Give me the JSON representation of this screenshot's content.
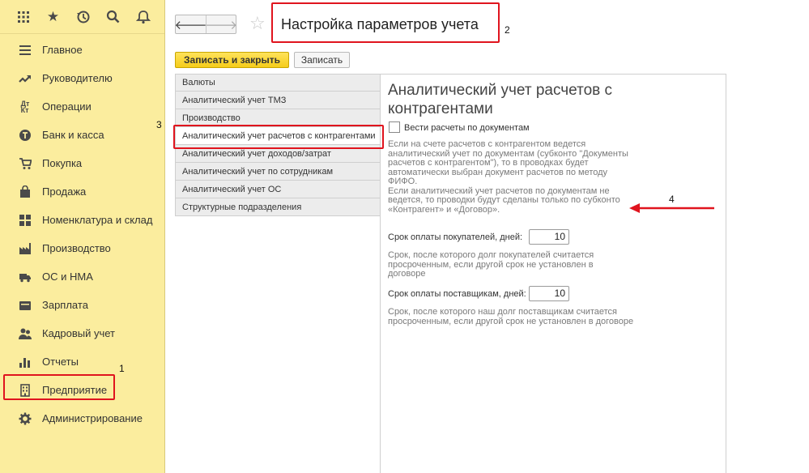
{
  "sidebar": {
    "top_icons": [
      "grid-icon",
      "star-icon",
      "history-icon",
      "search-icon",
      "bell-icon"
    ],
    "items": [
      {
        "label": "Главное",
        "icon": "menu-icon"
      },
      {
        "label": "Руководителю",
        "icon": "trend-icon"
      },
      {
        "label": "Операции",
        "icon": "dt-kt-icon"
      },
      {
        "label": "Банк и касса",
        "icon": "coin-icon"
      },
      {
        "label": "Покупка",
        "icon": "cart-icon"
      },
      {
        "label": "Продажа",
        "icon": "bag-icon"
      },
      {
        "label": "Номенклатура и склад",
        "icon": "warehouse-icon"
      },
      {
        "label": "Производство",
        "icon": "factory-icon"
      },
      {
        "label": "ОС и НМА",
        "icon": "truck-icon"
      },
      {
        "label": "Зарплата",
        "icon": "wallet-icon"
      },
      {
        "label": "Кадровый учет",
        "icon": "people-icon"
      },
      {
        "label": "Отчеты",
        "icon": "chart-icon"
      },
      {
        "label": "Предприятие",
        "icon": "building-icon"
      },
      {
        "label": "Администрирование",
        "icon": "gear-icon"
      }
    ]
  },
  "header": {
    "title": "Настройка параметров учета"
  },
  "toolbar": {
    "save_close": "Записать и закрыть",
    "save": "Записать"
  },
  "sections": [
    "Валюты",
    "Аналитический учет ТМЗ",
    "Производство",
    "Аналитический учет расчетов с контрагентами",
    "Аналитический учет доходов/затрат",
    "Аналитический учет по сотрудникам",
    "Аналитический учет ОС",
    "Структурные подразделения"
  ],
  "content": {
    "title": "Аналитический учет расчетов с контрагентами",
    "checkbox_label": "Вести расчеты по документам",
    "hint1_lines": [
      "Если на счете расчетов с контрагентом ведется",
      "аналитический учет по документам (субконто \"Документы",
      "расчетов с контрагентом\"), то в проводках будет",
      "автоматически выбран  документ расчетов по методу",
      "ФИФО.",
      "Если аналитический учет расчетов по документам не",
      "ведется, то проводки будут сделаны только по субконто",
      "«Контрагент» и «Договор»."
    ],
    "field1_label": "Срок оплаты покупателей, дней:",
    "field1_value": "10",
    "hint2_lines": [
      "Срок, после которого долг покупателей считается",
      "просроченным, если другой срок не установлен в",
      "договоре"
    ],
    "field2_label": "Срок оплаты поставщикам, дней:",
    "field2_value": "10",
    "hint3_lines": [
      "Срок, после которого наш долг поставщикам считается",
      "просроченным, если другой срок не установлен в договоре"
    ]
  },
  "annotations": {
    "n1": "1",
    "n2": "2",
    "n3": "3",
    "n4": "4",
    "color": "#e0141e"
  },
  "colors": {
    "sidebar_bg": "#fbed9e",
    "primary_button": "#f5cc1a"
  }
}
